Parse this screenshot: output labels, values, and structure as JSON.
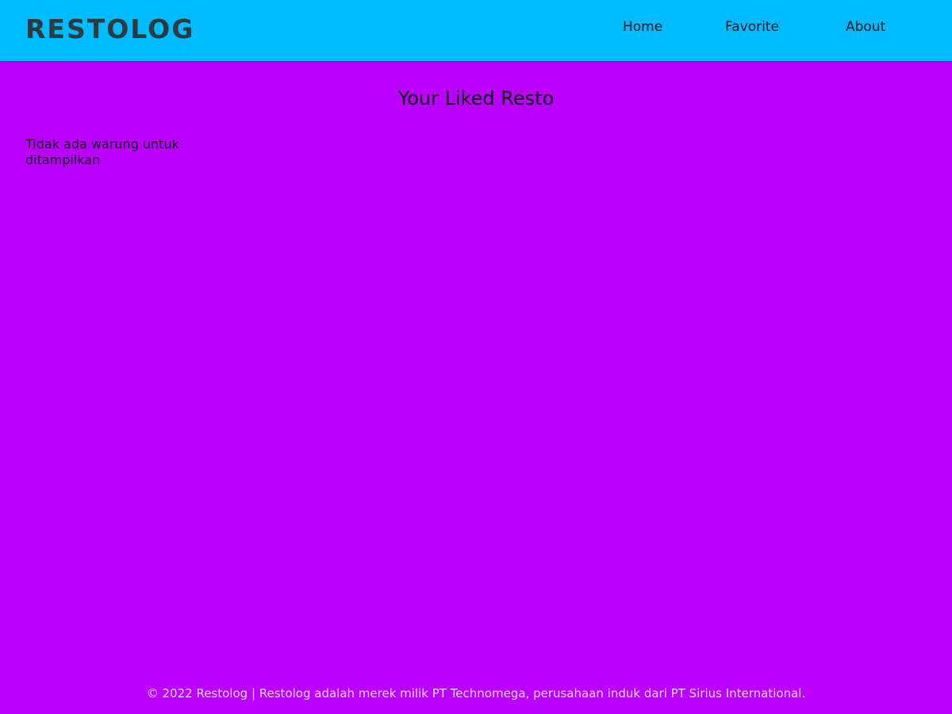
{
  "header": {
    "brand": "RESTOLOG",
    "nav": [
      {
        "label": "Home"
      },
      {
        "label": "Favorite"
      },
      {
        "label": "About"
      }
    ]
  },
  "main": {
    "title": "Your Liked Resto",
    "empty_message": "Tidak ada warung untuk ditampilkan"
  },
  "footer": {
    "text": "© 2022 Restolog | Restolog adalah merek milik PT Technomega, perusahaan induk dari PT Sirius International."
  },
  "colors": {
    "header_bg": "#00bbff",
    "page_bg": "#bb00ff",
    "brand_text": "#2f3a3f",
    "footer_text": "#e8d8f4"
  }
}
